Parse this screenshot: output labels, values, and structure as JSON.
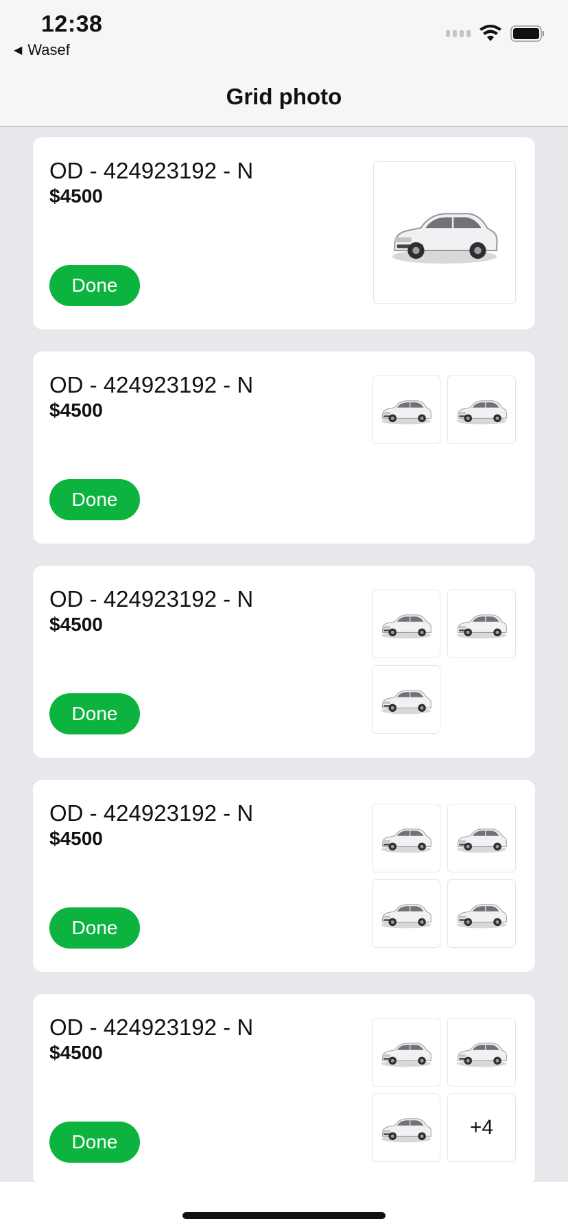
{
  "status": {
    "time": "12:38",
    "back_app": "Wasef"
  },
  "nav": {
    "title": "Grid photo"
  },
  "cards": [
    {
      "title": "OD - 424923192 - N",
      "price": "$4500",
      "done_label": "Done",
      "photo_count": 1,
      "more_label": ""
    },
    {
      "title": "OD - 424923192 - N",
      "price": "$4500",
      "done_label": "Done",
      "photo_count": 2,
      "more_label": ""
    },
    {
      "title": "OD - 424923192 - N",
      "price": "$4500",
      "done_label": "Done",
      "photo_count": 3,
      "more_label": ""
    },
    {
      "title": "OD - 424923192 - N",
      "price": "$4500",
      "done_label": "Done",
      "photo_count": 4,
      "more_label": ""
    },
    {
      "title": "OD - 424923192 - N",
      "price": "$4500",
      "done_label": "Done",
      "photo_count": 3,
      "more_label": "+4"
    }
  ],
  "icons": {
    "thumbnail": "car-photo-icon",
    "wifi": "wifi-icon",
    "battery": "battery-icon",
    "back": "back-arrow-icon"
  },
  "colors": {
    "accent": "#0db33f",
    "background": "#e7e7ec",
    "card": "#ffffff"
  }
}
